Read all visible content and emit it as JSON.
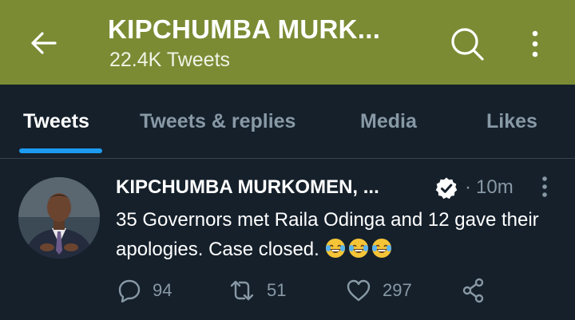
{
  "header": {
    "title": "KIPCHUMBA MURK...",
    "subtitle": "22.4K Tweets",
    "icons": [
      "back-arrow-icon",
      "search-icon",
      "more-vertical-icon"
    ]
  },
  "tabs": [
    {
      "label": "Tweets",
      "active": true
    },
    {
      "label": "Tweets & replies",
      "active": false
    },
    {
      "label": "Media",
      "active": false
    },
    {
      "label": "Likes",
      "active": false
    }
  ],
  "tweet": {
    "author": "KIPCHUMBA MURKOMEN, ...",
    "separator": "·",
    "time": "10m",
    "text": "35 Governors met Raila Odinga and 12 gave their apologies. Case closed.",
    "emojis": [
      "face-with-tears-of-joy",
      "face-with-tears-of-joy",
      "face-with-tears-of-joy"
    ],
    "replies": "94",
    "retweets": "51",
    "likes": "297"
  },
  "colors": {
    "header_bg": "#7b8b34",
    "page_bg": "#15202b",
    "muted": "#8899a6",
    "accent": "#1d9bf0"
  }
}
